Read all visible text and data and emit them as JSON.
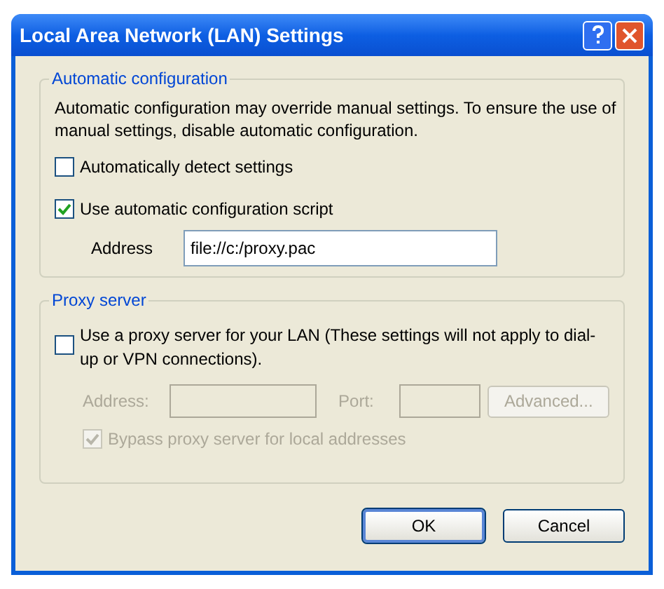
{
  "window": {
    "title": "Local Area Network (LAN) Settings"
  },
  "automatic_configuration": {
    "legend": "Automatic configuration",
    "description": "Automatic configuration may override manual settings.  To ensure the use of manual settings, disable automatic configuration.",
    "options": [
      {
        "label": "Automatically detect settings",
        "checked": false
      },
      {
        "label": "Use automatic configuration script",
        "checked": true
      }
    ],
    "address": {
      "label": "Address",
      "value": "file://c:/proxy.pac"
    }
  },
  "proxy_server": {
    "legend": "Proxy server",
    "use_proxy": {
      "label": "Use a proxy server for your LAN (These settings will not apply to dial-up or VPN connections).",
      "checked": false
    },
    "address": {
      "label": "Address:",
      "disabled": true
    },
    "port": {
      "label": "Port:",
      "disabled": true
    },
    "advanced_button": {
      "label": "Advanced...",
      "disabled": true
    },
    "bypass": {
      "label": "Bypass proxy server for local addresses",
      "checked": true,
      "disabled": true
    }
  },
  "buttons": [
    {
      "label": "OK",
      "default": true
    },
    {
      "label": "Cancel",
      "default": false
    }
  ]
}
